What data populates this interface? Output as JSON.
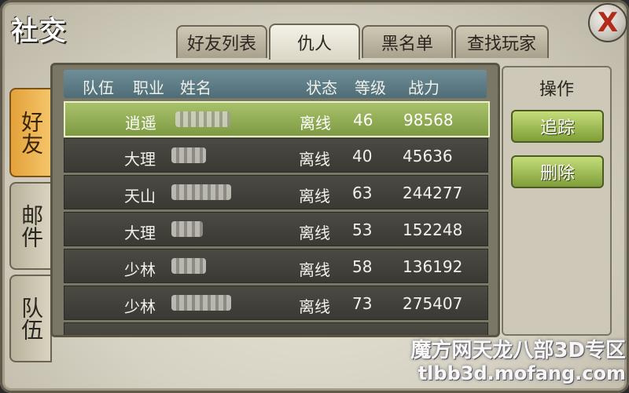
{
  "window": {
    "title": "社交",
    "close_label": "X"
  },
  "tabs": [
    {
      "label": "好友列表",
      "active": false
    },
    {
      "label": "仇人",
      "active": true
    },
    {
      "label": "黑名单",
      "active": false
    },
    {
      "label": "查找玩家",
      "active": false
    }
  ],
  "side_tabs": [
    {
      "label": "好友",
      "active": true
    },
    {
      "label": "邮件",
      "active": false
    },
    {
      "label": "队伍",
      "active": false
    }
  ],
  "table": {
    "headers": {
      "team": "队伍",
      "class": "职业",
      "name": "姓名",
      "status": "状态",
      "level": "等级",
      "power": "战力"
    },
    "rows": [
      {
        "class": "逍遥",
        "status": "离线",
        "level": "46",
        "power": "98568",
        "selected": true
      },
      {
        "class": "大理",
        "status": "离线",
        "level": "40",
        "power": "45636",
        "selected": false
      },
      {
        "class": "天山",
        "status": "离线",
        "level": "63",
        "power": "244277",
        "selected": false
      },
      {
        "class": "大理",
        "status": "离线",
        "level": "53",
        "power": "152248",
        "selected": false
      },
      {
        "class": "少林",
        "status": "离线",
        "level": "58",
        "power": "136192",
        "selected": false
      },
      {
        "class": "少林",
        "status": "离线",
        "level": "73",
        "power": "275407",
        "selected": false
      }
    ]
  },
  "operations": {
    "title": "操作",
    "track_label": "追踪",
    "delete_label": "删除"
  },
  "watermark": {
    "line1": "魔方网天龙八部3D专区",
    "line2": "tlbb3d.mofang.com"
  }
}
